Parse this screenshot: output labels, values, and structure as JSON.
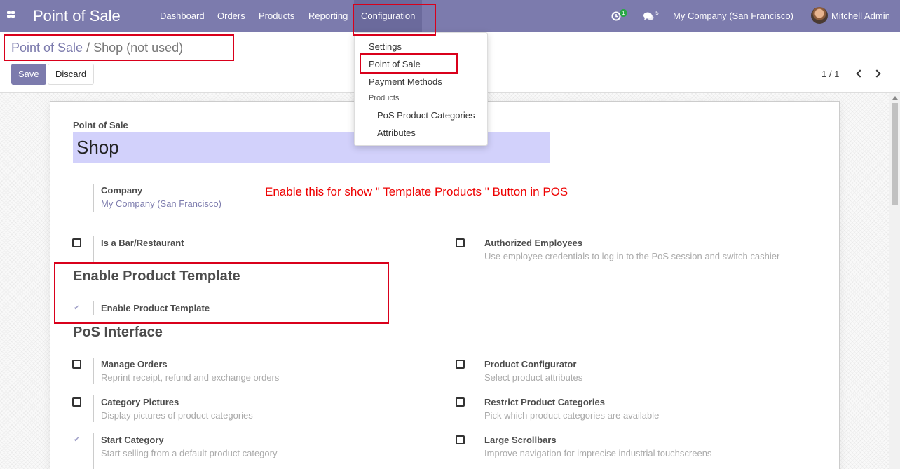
{
  "navbar": {
    "app_title": "Point of Sale",
    "menus": [
      "Dashboard",
      "Orders",
      "Products",
      "Reporting",
      "Configuration"
    ],
    "activity_badge": "1",
    "messages_badge": "5",
    "company": "My Company (San Francisco)",
    "user": "Mitchell Admin"
  },
  "breadcrumb": {
    "parent": "Point of Sale",
    "separator": "/",
    "current": "Shop (not used)"
  },
  "buttons": {
    "save": "Save",
    "discard": "Discard"
  },
  "pager": {
    "value": "1 / 1"
  },
  "dropdown": {
    "items": [
      "Settings",
      "Point of Sale",
      "Payment Methods"
    ],
    "section_header": "Products",
    "sub_items": [
      "PoS Product Categories",
      "Attributes"
    ]
  },
  "form": {
    "name_label": "Point of Sale",
    "name_value": "Shop",
    "company_label": "Company",
    "company_value": "My Company (San Francisco)",
    "annotation": "Enable this for show \" Template Products \" Button in POS",
    "is_bar_label": "Is a Bar/Restaurant",
    "authorized_label": "Authorized Employees",
    "authorized_desc": "Use employee credentials to log in to the PoS session and switch cashier",
    "template_section": "Enable Product Template",
    "template_label": "Enable Product Template",
    "interface_section": "PoS Interface",
    "options": [
      {
        "label": "Manage Orders",
        "desc": "Reprint receipt, refund and exchange orders"
      },
      {
        "label": "Product Configurator",
        "desc": "Select product attributes"
      },
      {
        "label": "Category Pictures",
        "desc": "Display pictures of product categories"
      },
      {
        "label": "Restrict Product Categories",
        "desc": "Pick which product categories are available"
      },
      {
        "label": "Start Category",
        "desc": "Start selling from a default product category"
      },
      {
        "label": "Large Scrollbars",
        "desc": "Improve navigation for imprecise industrial touchscreens"
      }
    ]
  },
  "colors": {
    "brand": "#7c7bad",
    "highlight": "#d9001b",
    "annotation": "#e00000",
    "input_bg": "#d2d1fb"
  }
}
